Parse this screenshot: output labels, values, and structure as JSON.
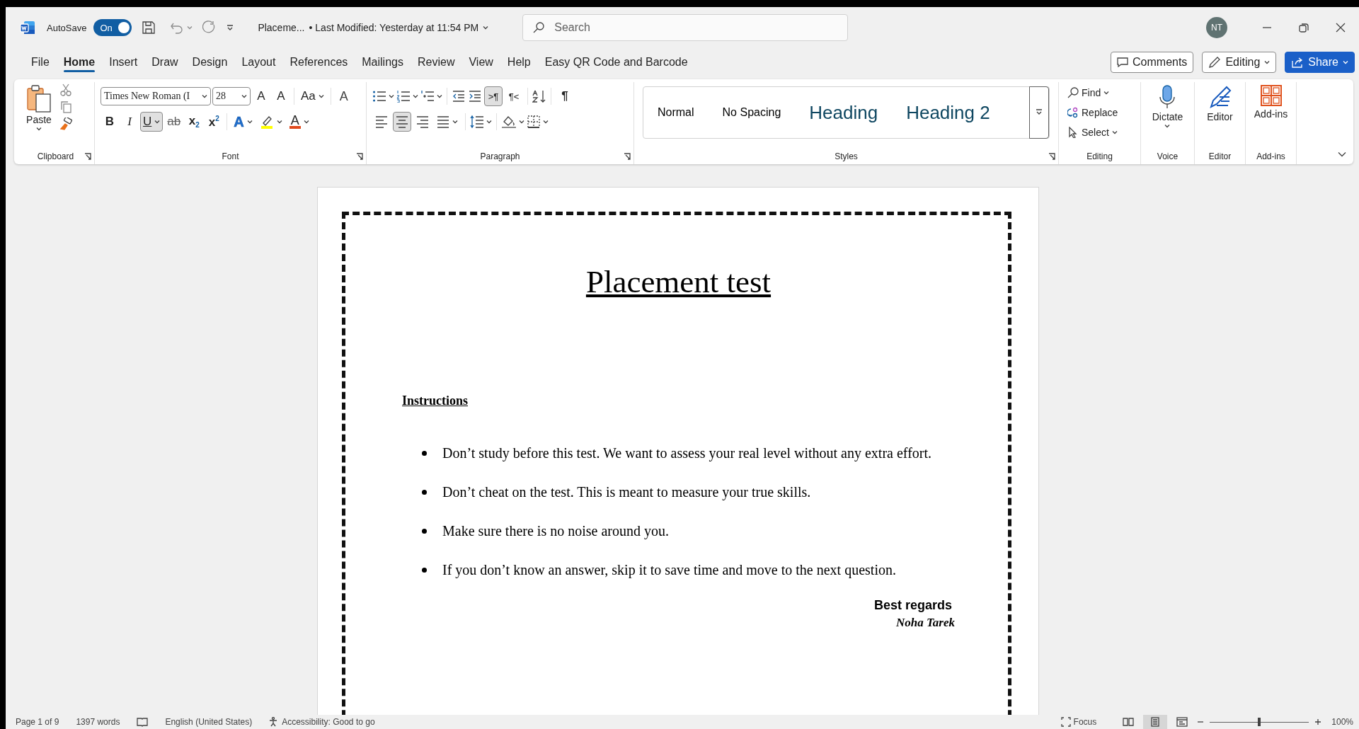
{
  "title_bar": {
    "autosave": {
      "label": "AutoSave",
      "on": true,
      "state": "On"
    },
    "document_name": "Placeme...",
    "last_modified": "• Last Modified: Yesterday at 11:54 PM",
    "search": {
      "placeholder": "Search"
    },
    "avatar": "NT"
  },
  "menu_tabs": [
    {
      "label": "File",
      "selected": false
    },
    {
      "label": "Home",
      "selected": true
    },
    {
      "label": "Insert",
      "selected": false
    },
    {
      "label": "Draw",
      "selected": false
    },
    {
      "label": "Design",
      "selected": false
    },
    {
      "label": "Layout",
      "selected": false
    },
    {
      "label": "References",
      "selected": false
    },
    {
      "label": "Mailings",
      "selected": false
    },
    {
      "label": "Review",
      "selected": false
    },
    {
      "label": "View",
      "selected": false
    },
    {
      "label": "Help",
      "selected": false
    },
    {
      "label": "Easy QR Code and Barcode",
      "selected": false
    }
  ],
  "header_buttons": [
    {
      "kind": "comments",
      "label": "Comments"
    },
    {
      "kind": "editing",
      "label": "Editing"
    },
    {
      "kind": "share",
      "label": "Share"
    }
  ],
  "ribbon": {
    "clipboard": {
      "label": "Clipboard",
      "paste": "Paste"
    },
    "font": {
      "label": "Font",
      "font_name": "Times New Roman (I",
      "font_size": "28",
      "tools": [
        {
          "kind": "grow",
          "label": "A"
        },
        {
          "kind": "shrink",
          "label": "A"
        },
        {
          "kind": "case",
          "label": "Aa"
        },
        {
          "kind": "clear",
          "label": "A"
        }
      ],
      "formats": [
        {
          "kind": "bold",
          "label": "B",
          "selected": false
        },
        {
          "kind": "italic",
          "label": "I",
          "selected": false
        },
        {
          "kind": "underline",
          "label": "U",
          "selected": true
        },
        {
          "kind": "strike",
          "label": "ab",
          "selected": false
        },
        {
          "kind": "subscript",
          "label": "x$_{2}$",
          "selected": false
        },
        {
          "kind": "superscript",
          "label": "x$^{2}$",
          "selected": false
        }
      ],
      "colors": [
        {
          "kind": "effects",
          "label": "A"
        },
        {
          "kind": "highlight",
          "color": "#ffff00"
        },
        {
          "kind": "font_color",
          "label": "A",
          "color": "#e04a1e"
        }
      ]
    },
    "paragraph": {
      "label": "Paragraph",
      "direction": [
        {
          "label": ">¶",
          "selected": true
        },
        {
          "label": "¶<",
          "selected": false
        }
      ],
      "show_marks": {
        "label": "¶",
        "selected": false
      },
      "alignment": [
        {
          "kind": "left",
          "selected": false
        },
        {
          "kind": "center",
          "selected": true
        },
        {
          "kind": "right",
          "selected": false
        },
        {
          "kind": "justify",
          "selected": false
        }
      ]
    },
    "styles": {
      "label": "Styles",
      "items": [
        {
          "label": "Normal",
          "kind": "body"
        },
        {
          "label": "No Spacing",
          "kind": "body"
        },
        {
          "label": "Heading",
          "kind": "heading"
        },
        {
          "label": "Heading 2",
          "kind": "heading"
        }
      ]
    },
    "editing": {
      "label": "Editing",
      "items": [
        {
          "kind": "find",
          "label": "Find"
        },
        {
          "kind": "replace",
          "label": "Replace"
        },
        {
          "kind": "select",
          "label": "Select"
        }
      ]
    },
    "commands": [
      {
        "kind": "dictate",
        "label": "Dictate",
        "group": "Voice"
      },
      {
        "kind": "editor",
        "label": "Editor",
        "group": "Editor"
      },
      {
        "kind": "addins",
        "label": "Add-ins",
        "group": "Add-ins"
      }
    ]
  },
  "document": {
    "title": "Placement test",
    "heading": "Instructions",
    "bullets": [
      "Don’t study before this test. We want to assess your real level without any extra effort.",
      "Don’t cheat on the test. This is meant to measure your true skills.",
      "Make sure there is no noise around you.",
      "If you don’t know an answer, skip it to save time and move to the next question."
    ],
    "closing": "Best regards",
    "signature": "Noha Tarek"
  },
  "status_bar": {
    "page": "Page 1 of 9",
    "words": "1397 words",
    "language": "English (United States)",
    "accessibility": "Accessibility: Good to go",
    "focus": "Focus",
    "views": [
      {
        "kind": "read",
        "selected": false
      },
      {
        "kind": "print",
        "selected": true
      },
      {
        "kind": "web",
        "selected": false
      }
    ],
    "zoom": {
      "level": 0.5,
      "label": "100%"
    }
  }
}
